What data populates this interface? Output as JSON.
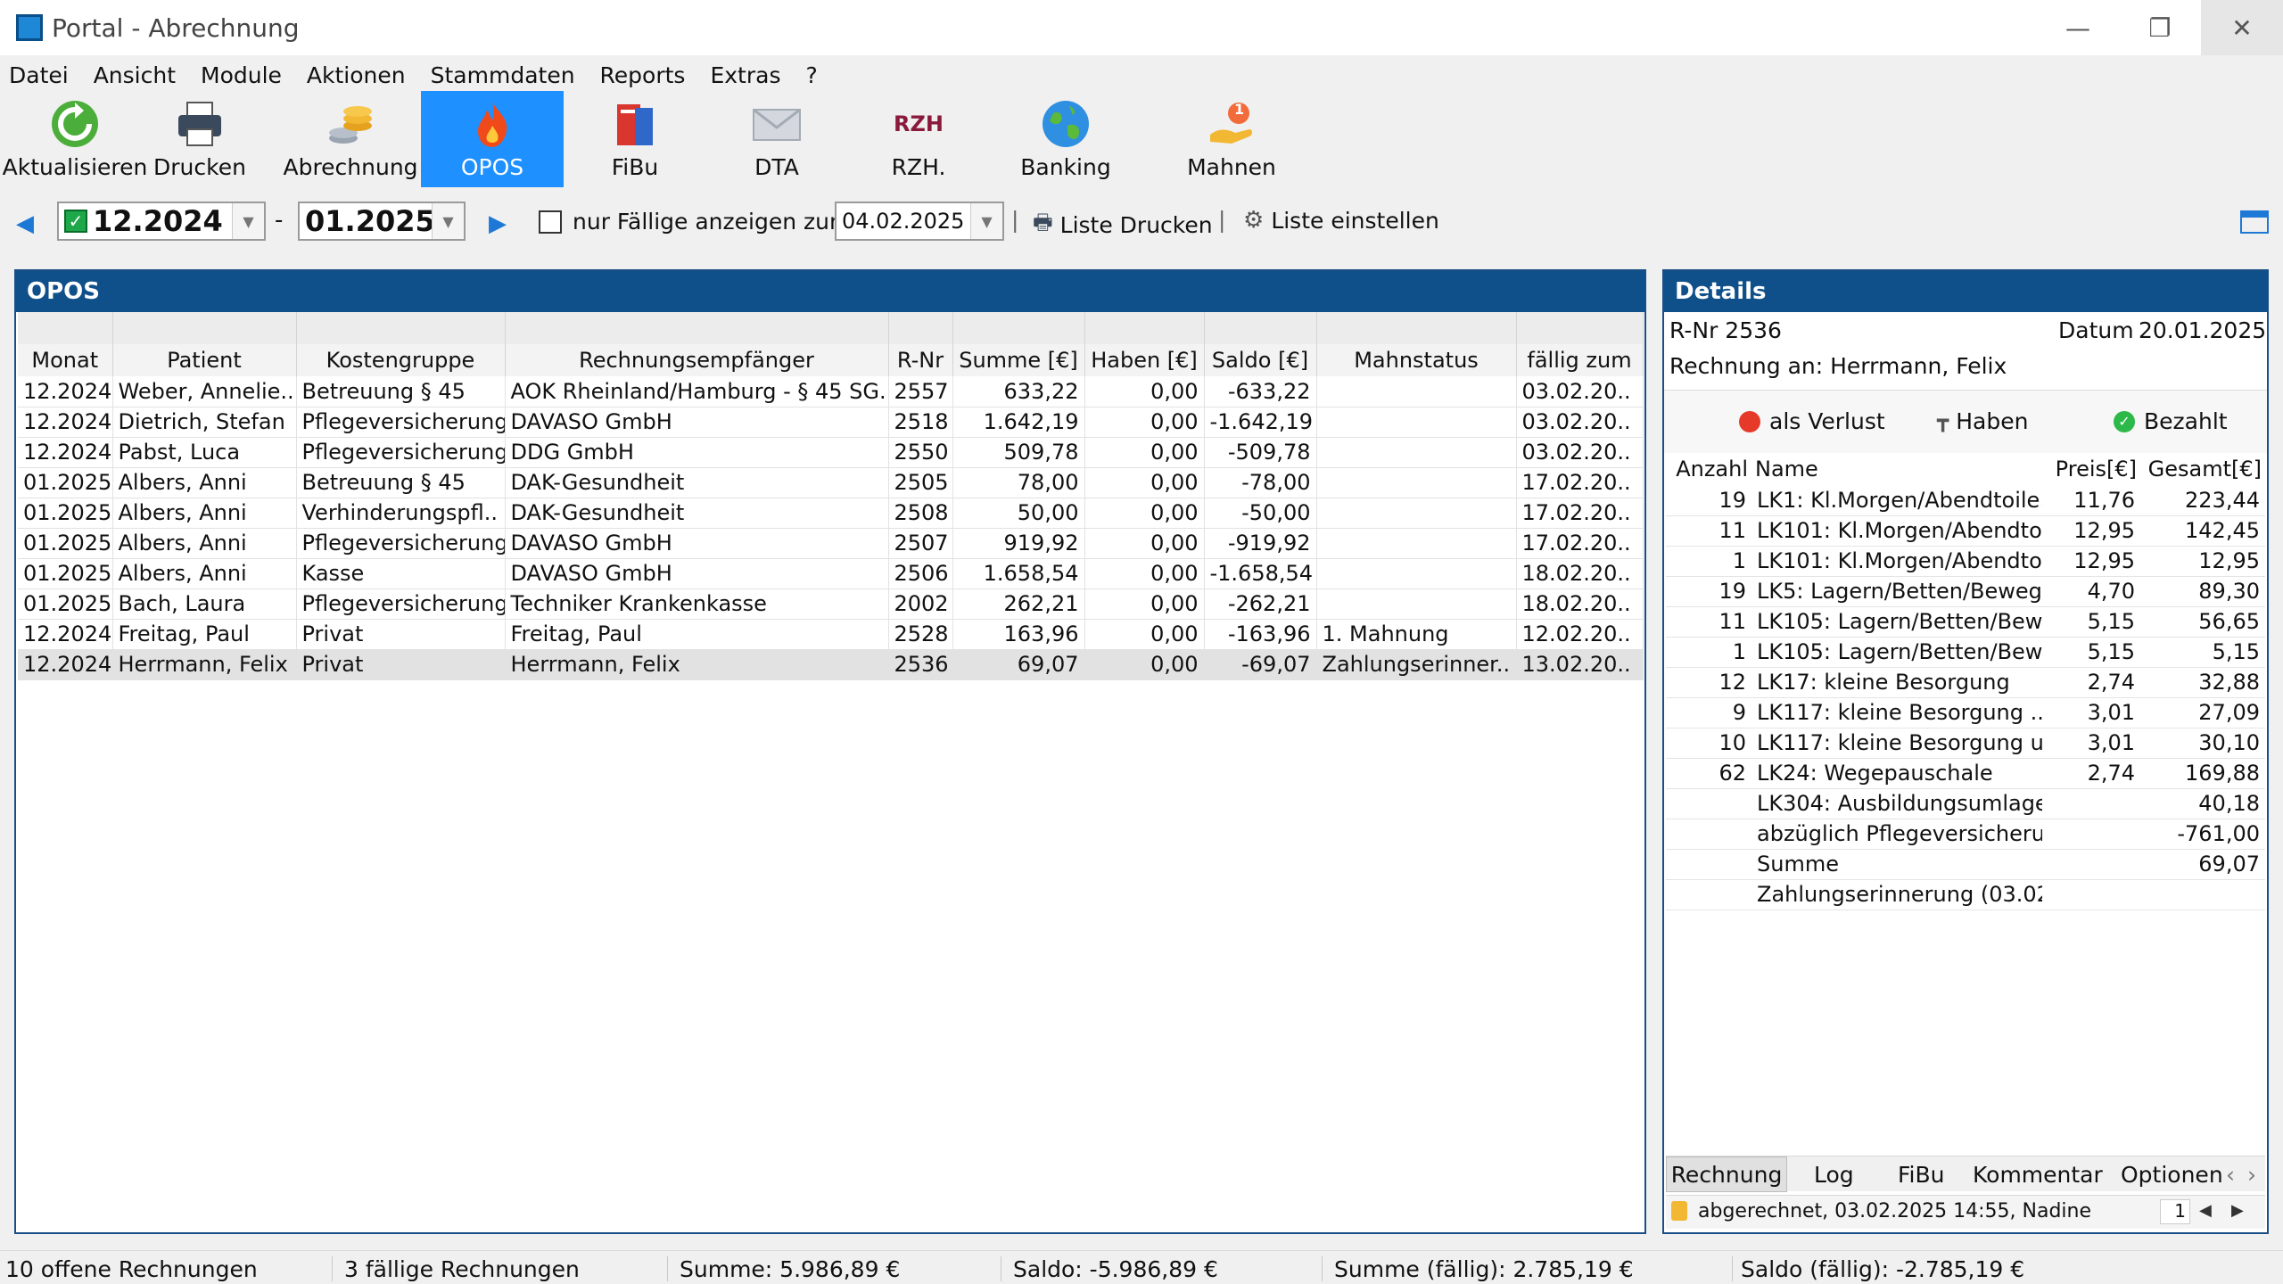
{
  "window": {
    "title": "Portal - Abrechnung",
    "minimize": "—",
    "restore": "❐",
    "close": "✕"
  },
  "menu": [
    "Datei",
    "Ansicht",
    "Module",
    "Aktionen",
    "Stammdaten",
    "Reports",
    "Extras",
    "?"
  ],
  "toolbar": {
    "items": [
      {
        "label": "Aktualisieren",
        "icon": "refresh-icon"
      },
      {
        "label": "Drucken",
        "icon": "printer-icon"
      },
      {
        "label": "Abrechnung",
        "icon": "coins-icon"
      },
      {
        "label": "OPOS",
        "icon": "flame-icon",
        "active": true
      },
      {
        "label": "FiBu",
        "icon": "books-icon"
      },
      {
        "label": "DTA",
        "icon": "envelope-icon"
      },
      {
        "label": "RZH.",
        "icon": "rzh-logo-icon",
        "logo_text": "RZH"
      },
      {
        "label": "Banking",
        "icon": "globe-icon"
      },
      {
        "label": "Mahnen",
        "icon": "hand-coin-icon",
        "badge": "1"
      }
    ]
  },
  "filter": {
    "from": "12.2024",
    "to": "01.2025",
    "dash": "-",
    "only_due_label": "nur Fällige anzeigen zum",
    "due_date": "04.02.2025",
    "print_list": "Liste Drucken",
    "configure_list": "Liste einstellen",
    "separator": "|"
  },
  "opos": {
    "title": "OPOS",
    "columns": [
      "Monat",
      "Patient",
      "Kostengruppe",
      "Rechnungsempfänger",
      "R-Nr",
      "Summe [€]",
      "Haben [€]",
      "Saldo [€]",
      "Mahnstatus",
      "fällig zum"
    ],
    "rows": [
      [
        "12.2024",
        "Weber, Annelie..",
        "Betreuung § 45",
        "AOK Rheinland/Hamburg - § 45 SG..",
        "2557",
        "633,22",
        "0,00",
        "-633,22",
        "",
        "03.02.20.."
      ],
      [
        "12.2024",
        "Dietrich, Stefan",
        "Pflegeversicherung",
        "DAVASO GmbH",
        "2518",
        "1.642,19",
        "0,00",
        "-1.642,19",
        "",
        "03.02.20.."
      ],
      [
        "12.2024",
        "Pabst, Luca",
        "Pflegeversicherung",
        "DDG GmbH",
        "2550",
        "509,78",
        "0,00",
        "-509,78",
        "",
        "03.02.20.."
      ],
      [
        "01.2025",
        "Albers, Anni",
        "Betreuung § 45",
        "DAK-Gesundheit",
        "2505",
        "78,00",
        "0,00",
        "-78,00",
        "",
        "17.02.20.."
      ],
      [
        "01.2025",
        "Albers, Anni",
        "Verhinderungspfl..",
        "DAK-Gesundheit",
        "2508",
        "50,00",
        "0,00",
        "-50,00",
        "",
        "17.02.20.."
      ],
      [
        "01.2025",
        "Albers, Anni",
        "Pflegeversicherung",
        "DAVASO GmbH",
        "2507",
        "919,92",
        "0,00",
        "-919,92",
        "",
        "17.02.20.."
      ],
      [
        "01.2025",
        "Albers, Anni",
        "Kasse",
        "DAVASO GmbH",
        "2506",
        "1.658,54",
        "0,00",
        "-1.658,54",
        "",
        "18.02.20.."
      ],
      [
        "01.2025",
        "Bach, Laura",
        "Pflegeversicherung",
        "Techniker Krankenkasse",
        "2002",
        "262,21",
        "0,00",
        "-262,21",
        "",
        "18.02.20.."
      ],
      [
        "12.2024",
        "Freitag, Paul",
        "Privat",
        "Freitag, Paul",
        "2528",
        "163,96",
        "0,00",
        "-163,96",
        "1. Mahnung",
        "12.02.20.."
      ],
      [
        "12.2024",
        "Herrmann, Felix",
        "Privat",
        "Herrmann, Felix",
        "2536",
        "69,07",
        "0,00",
        "-69,07",
        "Zahlungserinner..",
        "13.02.20.."
      ]
    ],
    "selected_row": 9
  },
  "details": {
    "title": "Details",
    "rnr": "R-Nr 2536",
    "datum_label": "Datum",
    "datum": "20.01.2025",
    "rechnung_an": "Rechnung an: Herrmann, Felix",
    "actions": {
      "loss": "als Verlust",
      "credit": "Haben",
      "paid": "Bezahlt"
    },
    "columns": [
      "Anzahl",
      "Name",
      "Preis[€]",
      "Gesamt[€]"
    ],
    "rows": [
      [
        "19",
        "LK1: Kl.Morgen/Abendtoile..",
        "11,76",
        "223,44"
      ],
      [
        "11",
        "LK101: Kl.Morgen/Abendto..",
        "12,95",
        "142,45"
      ],
      [
        "1",
        "LK101: Kl.Morgen/Abendto..",
        "12,95",
        "12,95"
      ],
      [
        "19",
        "LK5: Lagern/Betten/Beweg..",
        "4,70",
        "89,30"
      ],
      [
        "11",
        "LK105: Lagern/Betten/Bew..",
        "5,15",
        "56,65"
      ],
      [
        "1",
        "LK105: Lagern/Betten/Bew..",
        "5,15",
        "5,15"
      ],
      [
        "12",
        "LK17: kleine Besorgung",
        "2,74",
        "32,88"
      ],
      [
        "9",
        "LK117: kleine Besorgung ..",
        "3,01",
        "27,09"
      ],
      [
        "10",
        "LK117: kleine Besorgung u..",
        "3,01",
        "30,10"
      ],
      [
        "62",
        "LK24: Wegepauschale",
        "2,74",
        "169,88"
      ],
      [
        "",
        "LK304: Ausbildungsumlage..",
        "",
        "40,18"
      ],
      [
        "",
        "abzüglich Pflegeversicherung",
        "",
        "-761,00"
      ],
      [
        "",
        "Summe",
        "",
        "69,07"
      ],
      [
        "",
        "Zahlungserinnerung (03.02..",
        "",
        ""
      ]
    ],
    "tabs": [
      "Rechnung",
      "Log",
      "FiBu",
      "Kommentar",
      "Optionen"
    ],
    "status_text": "abgerechnet, 03.02.2025 14:55, Nadine",
    "page_number": "1"
  },
  "statusbar": {
    "open": "10 offene Rechnungen",
    "due": "3 fällige Rechnungen",
    "sum": "Summe: 5.986,89 €",
    "saldo": "Saldo: -5.986,89 €",
    "sum_due": "Summe (fällig): 2.785,19 €",
    "saldo_due": "Saldo (fällig): -2.785,19 €"
  },
  "colors": {
    "accent": "#1e90ff",
    "panel_header": "#10508a",
    "selected_row": "#e2e2e2"
  }
}
